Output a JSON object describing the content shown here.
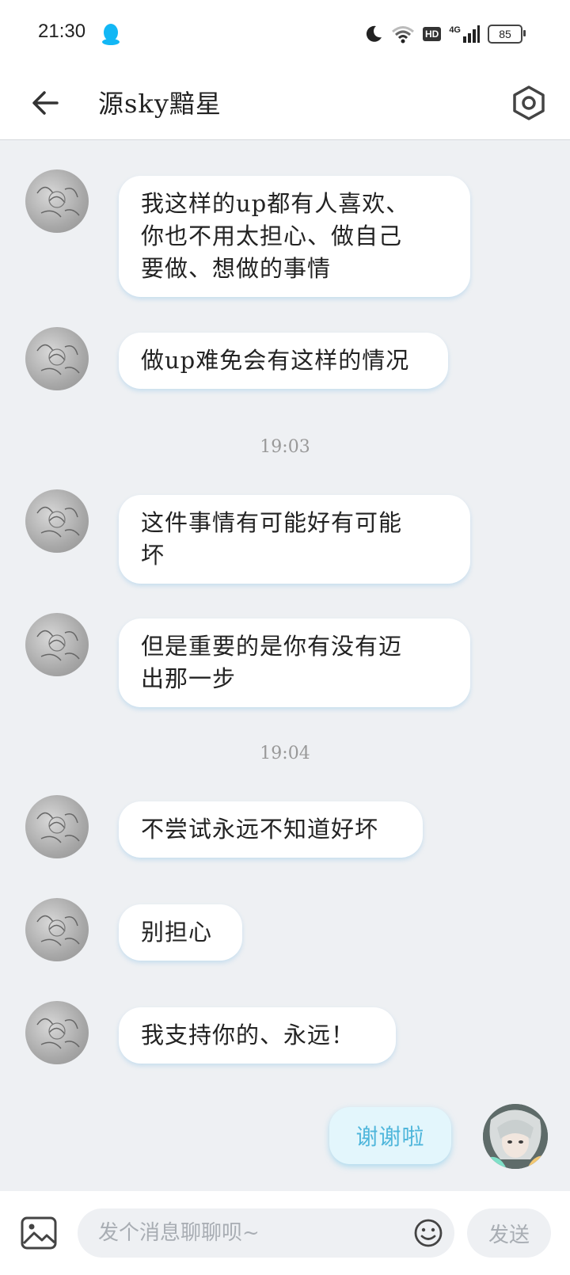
{
  "status_bar": {
    "time": "21:30",
    "network": "4G",
    "hd_label": "HD",
    "battery": "85"
  },
  "header": {
    "title": "源sky黯星"
  },
  "messages": [
    {
      "lines": [
        "我这样的up都有人喜欢、",
        "你也不用太担心、做自己",
        "要做、想做的事情"
      ]
    },
    {
      "lines": [
        "做up难免会有这样的情况"
      ]
    },
    {
      "timestamp": "19:03"
    },
    {
      "lines": [
        "这件事情有可能好有可能",
        "坏"
      ]
    },
    {
      "lines": [
        "但是重要的是你有没有迈",
        "出那一步"
      ]
    },
    {
      "timestamp": "19:04"
    },
    {
      "lines": [
        "不尝试永远不知道好坏"
      ]
    },
    {
      "lines": [
        "别担心"
      ]
    },
    {
      "lines": [
        "我支持你的、永远！"
      ]
    }
  ],
  "my_message": "谢谢啦",
  "input_bar": {
    "placeholder": "发个消息聊聊呗~",
    "send_label": "发送"
  },
  "colors": {
    "background": "#eef0f3",
    "my_bubble": "#e3f6fc",
    "my_text": "#4fb6db",
    "qq_blue": "#12b7f5"
  }
}
